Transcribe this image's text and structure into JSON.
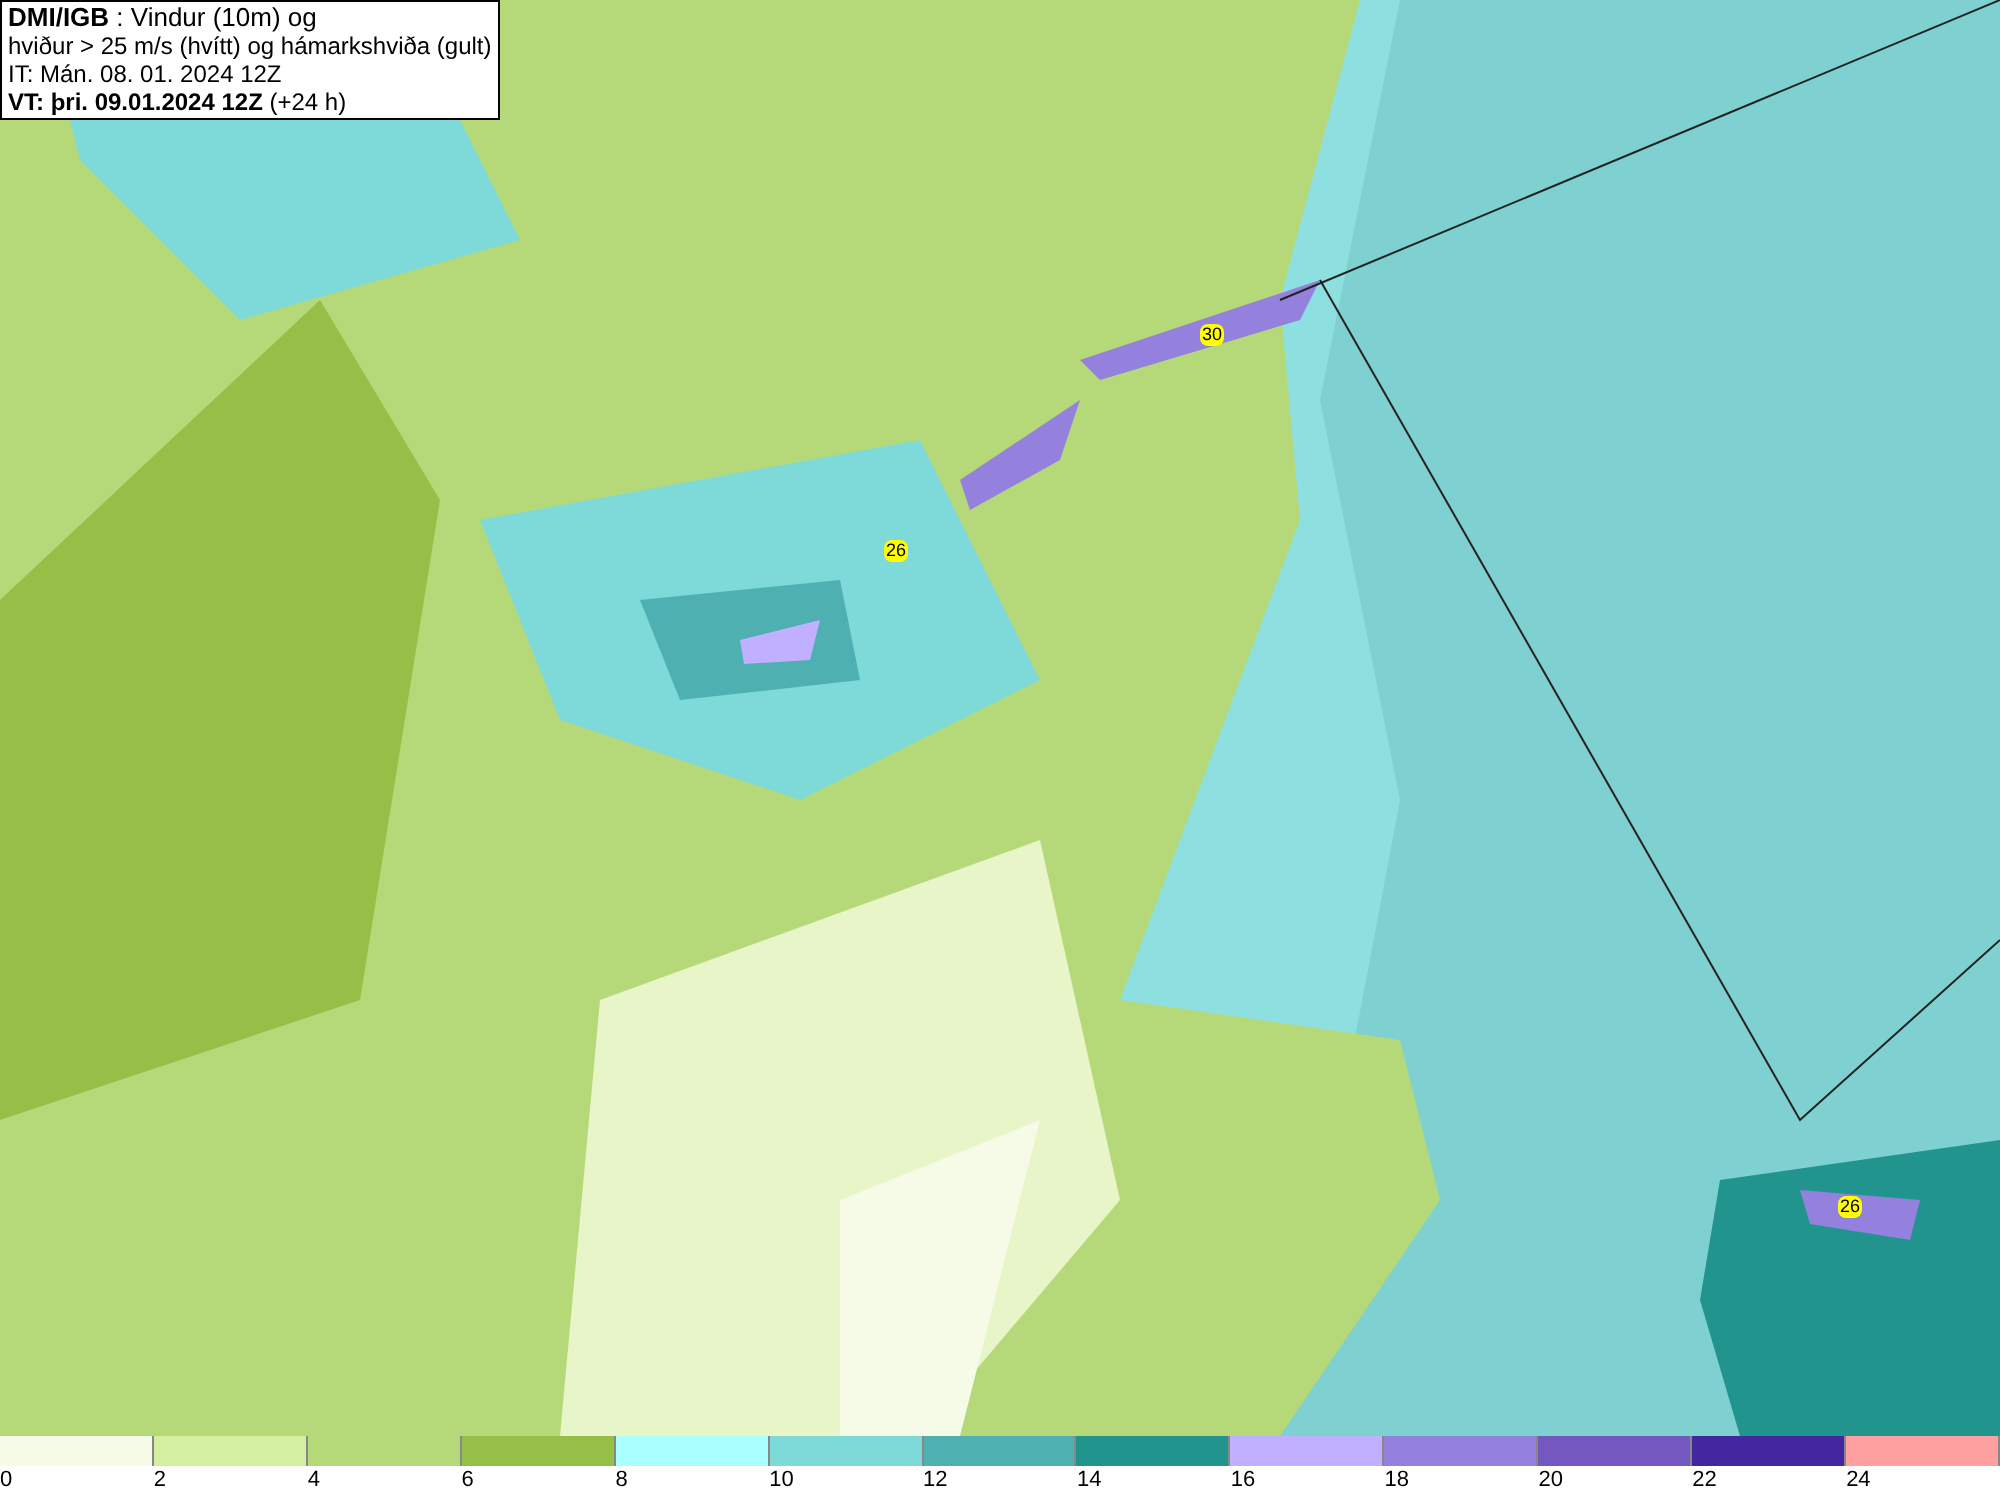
{
  "title_box": {
    "lines": [
      "**DMI/IGB** : Vindur (10m) og",
      "hviður > 25 m/s (hvítt) og hámarkshviða (gult)",
      "IT: Mán. 08. 01. 2024 12Z",
      "**VT: þri. 09.01.2024 12Z** (+24 h)"
    ]
  },
  "gust_labels": [
    "30",
    "26",
    "26"
  ],
  "legend": [
    {
      "label": "0",
      "color": "#f5fbe6"
    },
    {
      "label": "2",
      "color": "#d5efa0"
    },
    {
      "label": "4",
      "color": "#b5d978"
    },
    {
      "label": "6",
      "color": "#96bf48"
    },
    {
      "label": "8",
      "color": "#aaffff"
    },
    {
      "label": "10",
      "color": "#7ed9d9"
    },
    {
      "label": "12",
      "color": "#4eb0b0"
    },
    {
      "label": "14",
      "color": "#22948e"
    },
    {
      "label": "16",
      "color": "#c0b0ff"
    },
    {
      "label": "18",
      "color": "#9480dd"
    },
    {
      "label": "20",
      "color": "#7458c0"
    },
    {
      "label": "22",
      "color": "#4426a0"
    },
    {
      "label": "24",
      "color": "#ffa0a0"
    }
  ]
}
